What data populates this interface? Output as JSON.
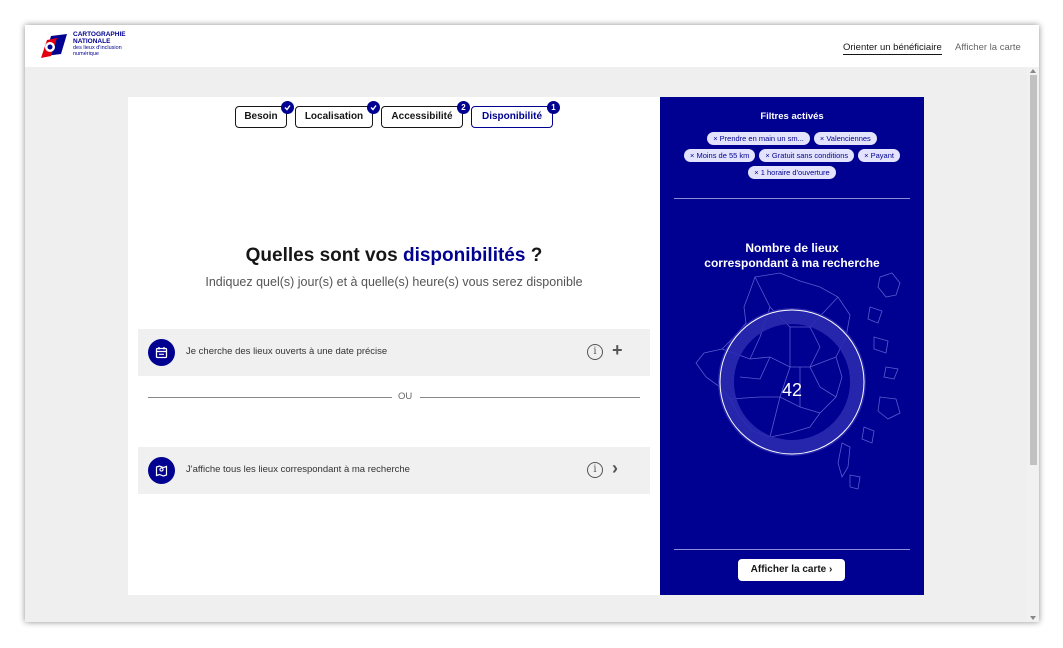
{
  "header": {
    "logo": {
      "line1": "CARTOGRAPHIE",
      "line2": "NATIONALE",
      "line3": "des lieux d'inclusion",
      "line4": "numérique"
    },
    "nav_primary": "Orienter un bénéficiaire",
    "nav_secondary": "Afficher la carte"
  },
  "steps": [
    {
      "label": "Besoin",
      "badge": "check",
      "active": false
    },
    {
      "label": "Localisation",
      "badge": "check",
      "active": false
    },
    {
      "label": "Accessibilité",
      "badge": "2",
      "active": false
    },
    {
      "label": "Disponibilité",
      "badge": "1",
      "active": true
    }
  ],
  "question": {
    "prefix": "Quelles sont vos",
    "highlight": "disponibilités",
    "suffix": "?",
    "subtitle": "Indiquez quel(s) jour(s) et à quelle(s) heure(s) vous serez disponible"
  },
  "options": {
    "date": {
      "label": "Je cherche des lieux ouverts à une date précise",
      "icon": "calendar-icon",
      "action": "+"
    },
    "all": {
      "label": "J'affiche tous les lieux correspondant à ma recherche",
      "icon": "map-pin-icon",
      "action": "›"
    },
    "info": "i"
  },
  "divider_label": "OU",
  "panel": {
    "filters_title": "Filtres activés",
    "filters": [
      "× Prendre en main un sm...",
      "× Valenciennes",
      "× Moins de 55 km",
      "× Gratuit sans conditions",
      "× Payant",
      "× 1 horaire d'ouverture"
    ],
    "count_title_line1": "Nombre de lieux",
    "count_title_line2": "correspondant à ma recherche",
    "count": "42",
    "map_button": "Afficher la carte ›"
  },
  "colors": {
    "brand_blue": "#000091",
    "chip_bg": "#e3e3fd",
    "option_bg": "#f0f0f0",
    "logo_red": "#e1000f"
  }
}
